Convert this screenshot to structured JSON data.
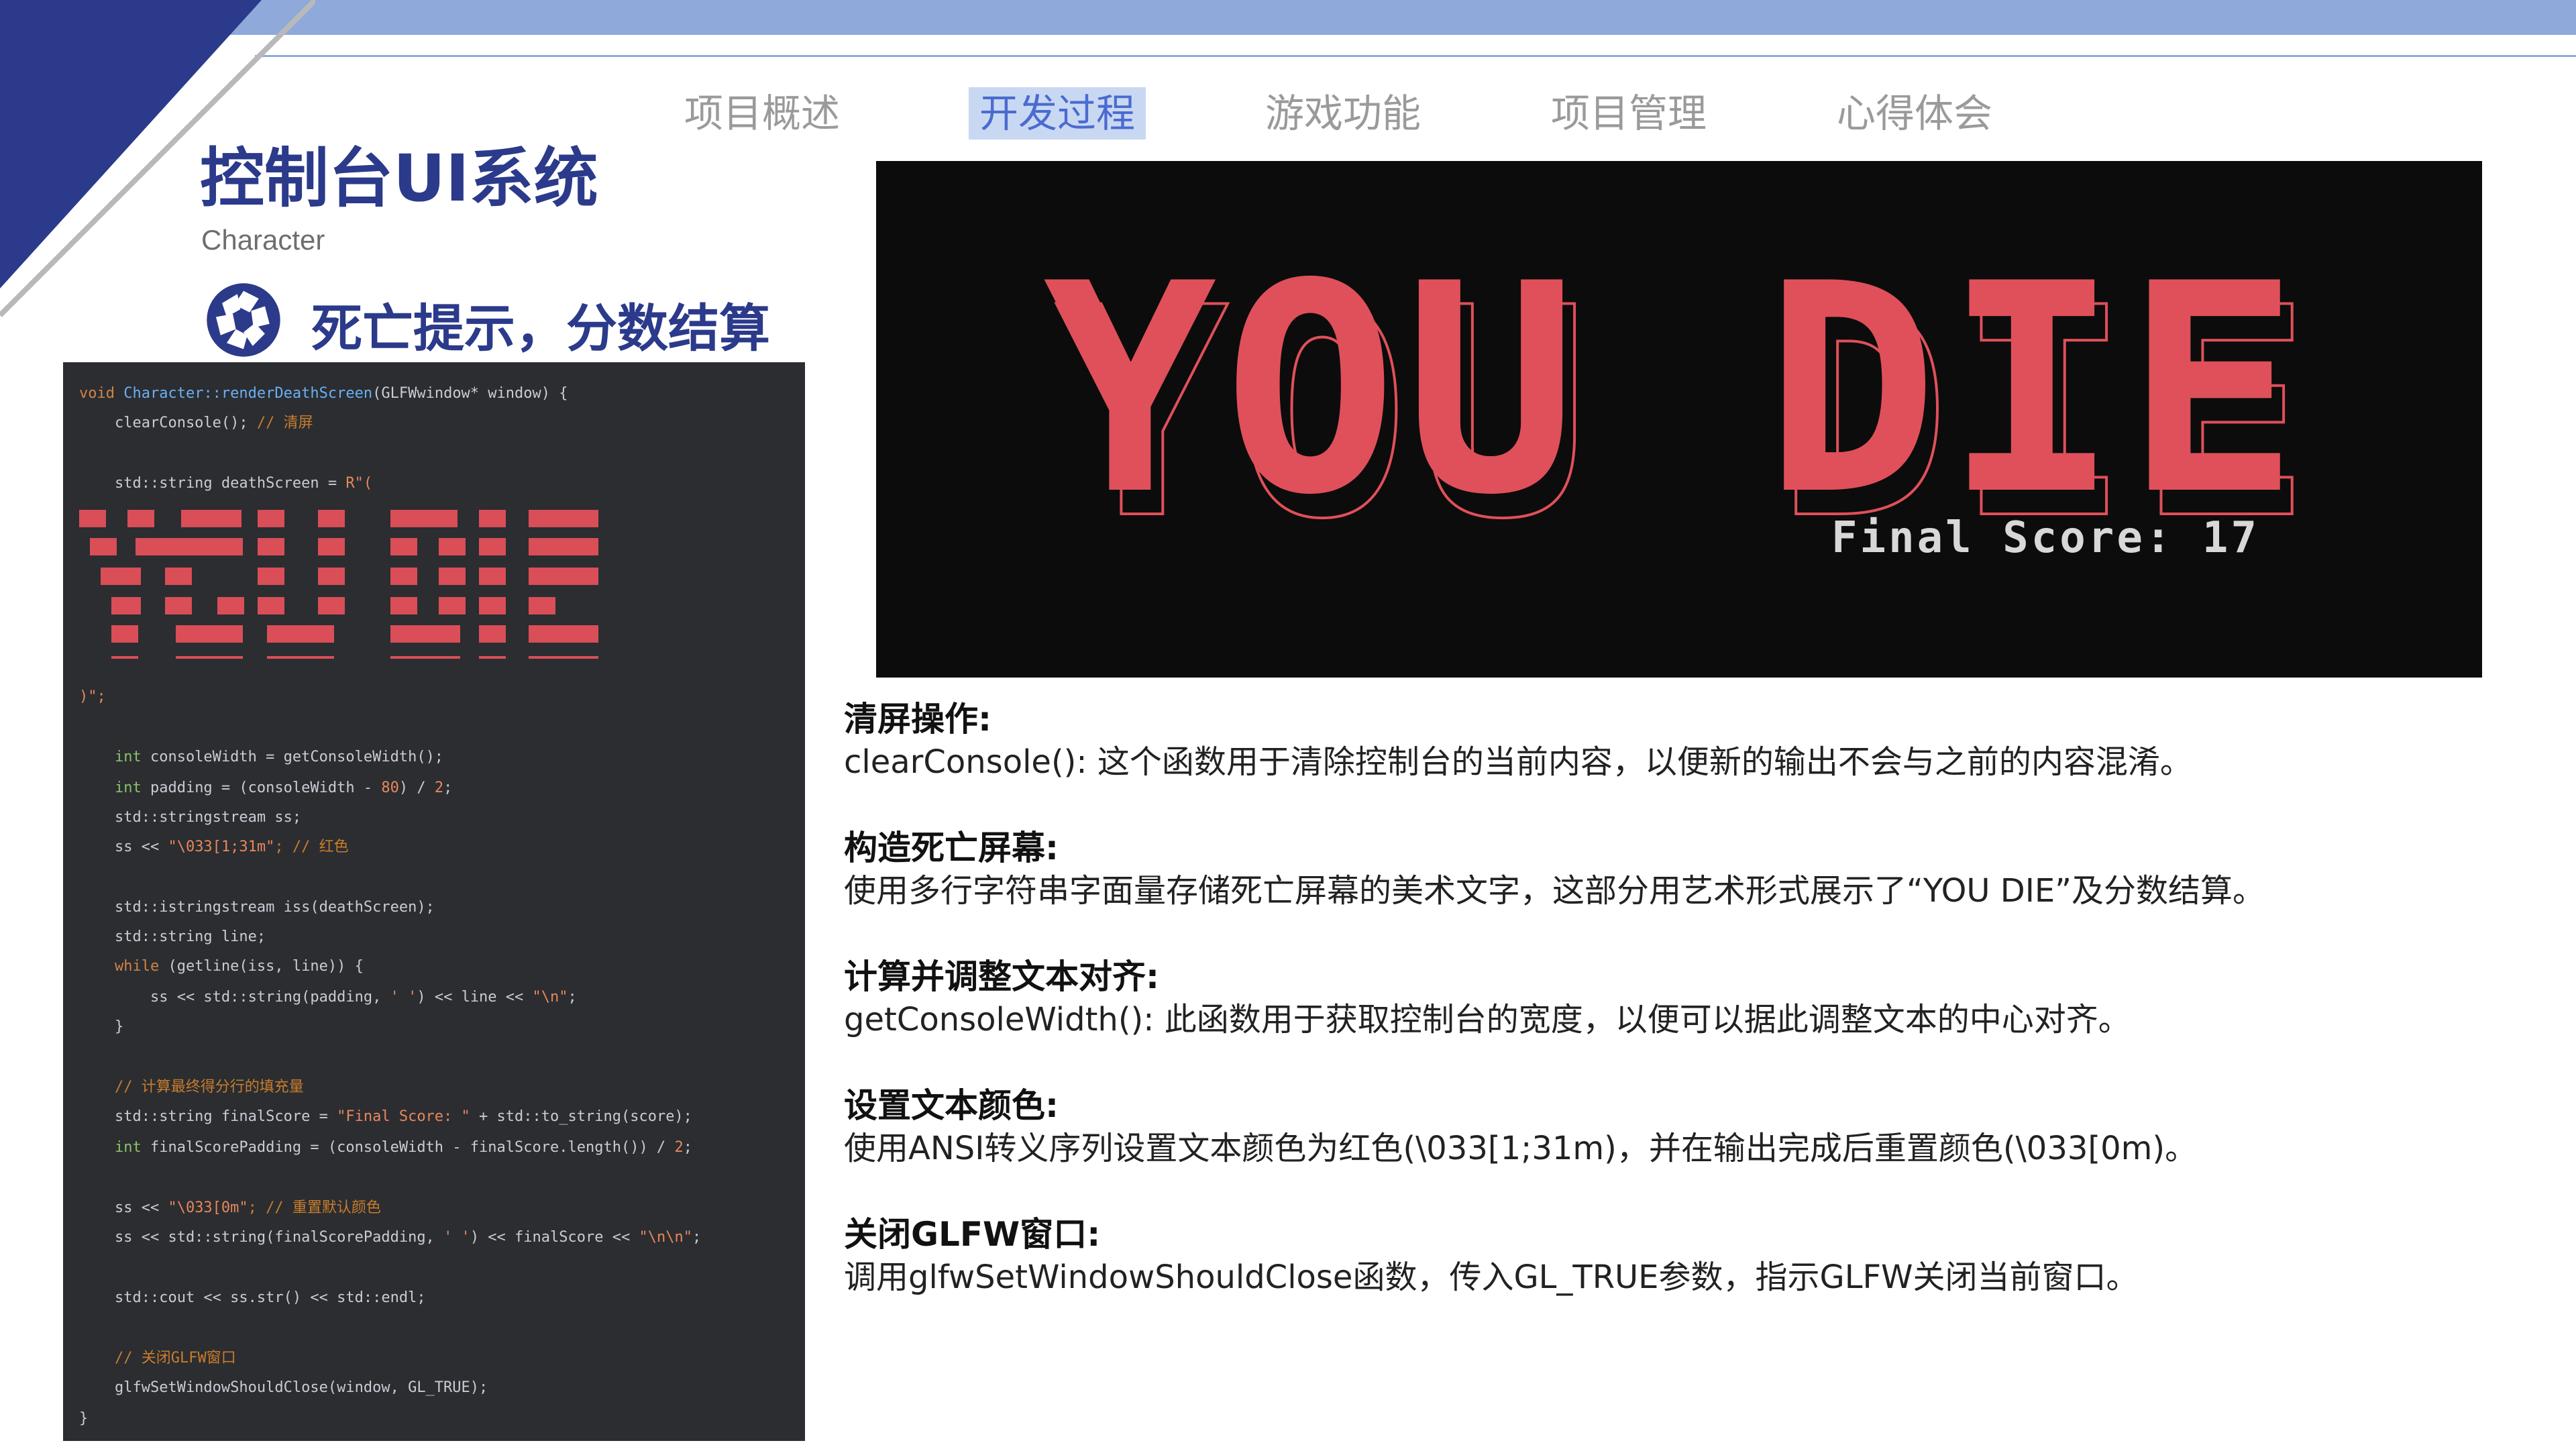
{
  "header": {
    "nav": [
      {
        "label": "项目概述"
      },
      {
        "label": "开发过程"
      },
      {
        "label": "游戏功能"
      },
      {
        "label": "项目管理"
      },
      {
        "label": "心得体会"
      }
    ],
    "active_nav": "开发过程",
    "accent_color": "#2b3a8a",
    "banner_color": "#8fa9db"
  },
  "page": {
    "title": "控制台UI系统",
    "subtitle": "Character",
    "section_title": "死亡提示，分数结算",
    "section_icon": "aperture-icon"
  },
  "code": {
    "line1_kw": "void",
    "line1_fn": "Character::renderDeathScreen",
    "line1_rest": "(GLFWwindow* window) {",
    "line2": "    clearConsole();",
    "line2_cm": " // 清屏",
    "line3": "    std::string deathScreen = ",
    "line3_str": "R\"(",
    "line4": ")\";",
    "line5_ty": "    int",
    "line5": " consoleWidth = getConsoleWidth();",
    "line6_ty": "    int",
    "line6": " padding = (consoleWidth - ",
    "line6_num": "80",
    "line6_end": ") / ",
    "line6_num2": "2",
    "line6_close": ";",
    "line7": "    std::stringstream ss;",
    "line8": "    ss << ",
    "line8_str": "\"\\033[1;31m\"",
    "line8_cm": "; // 红色",
    "line9": "    std::istringstream iss(deathScreen);",
    "line10": "    std::string line;",
    "line11_kw": "    while",
    "line11": " (getline(iss, line)) {",
    "line12": "        ss << std::string(padding, ",
    "line12_str": "' '",
    "line12_mid": ") << line << ",
    "line12_str2": "\"\\n\"",
    "line12_end": ";",
    "line13": "    }",
    "line14_cm": "    // 计算最终得分行的填充量",
    "line15": "    std::string finalScore = ",
    "line15_str": "\"Final Score: \"",
    "line15_end": " + std::to_string(score);",
    "line16_ty": "    int",
    "line16": " finalScorePadding = (consoleWidth - finalScore.length()) / ",
    "line16_num": "2",
    "line16_end": ";",
    "line17": "    ss << ",
    "line17_str": "\"\\033[0m\"",
    "line17_cm": "; // 重置默认颜色",
    "line18": "    ss << std::string(finalScorePadding, ",
    "line18_str": "' '",
    "line18_mid": ") << finalScore << ",
    "line18_str2": "\"\\n\\n\"",
    "line18_end": ";",
    "line19": "    std::cout << ss.str() << std::endl;",
    "line20_cm": "    // 关闭GLFW窗口",
    "line21": "    glfwSetWindowShouldClose(window, GL_TRUE);",
    "line22": "}"
  },
  "game_screen": {
    "big_text": "YOU DIE",
    "final_score": "Final Score: 17",
    "text_color": "#e0505a"
  },
  "descriptions": [
    {
      "heading": "清屏操作:",
      "body": "clearConsole(): 这个函数用于清除控制台的当前内容，以便新的输出不会与之前的内容混淆。"
    },
    {
      "heading": "构造死亡屏幕:",
      "body": "使用多行字符串字面量存储死亡屏幕的美术文字，这部分用艺术形式展示了“YOU DIE”及分数结算。"
    },
    {
      "heading": "计算并调整文本对齐:",
      "body": "getConsoleWidth(): 此函数用于获取控制台的宽度，以便可以据此调整文本的中心对齐。"
    },
    {
      "heading": "设置文本颜色:",
      "body": "使用ANSI转义序列设置文本颜色为红色(\\033[1;31m)，并在输出完成后重置颜色(\\033[0m)。"
    },
    {
      "heading": "关闭GLFW窗口:",
      "body": "调用glfwSetWindowShouldClose函数，传入GL_TRUE参数，指示GLFW关闭当前窗口。"
    }
  ]
}
